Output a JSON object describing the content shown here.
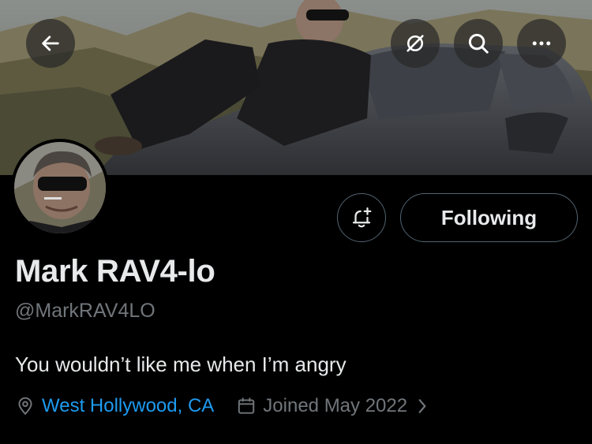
{
  "header": {
    "back_icon": "arrow-left-icon",
    "actions": [
      {
        "name": "grok-icon"
      },
      {
        "name": "search-icon"
      },
      {
        "name": "more-icon"
      }
    ]
  },
  "profile": {
    "display_name": "Mark RAV4-lo",
    "handle": "@MarkRAV4LO",
    "bio": "You wouldn’t like me when I’m angry",
    "location": "West Hollywood, CA",
    "joined": "Joined May 2022",
    "follow_button_label": "Following",
    "notification_icon": "bell-plus-icon"
  },
  "colors": {
    "background": "#000000",
    "text_primary": "#e7e9ea",
    "text_secondary": "#71767b",
    "link": "#1d9bf0",
    "border": "#536471"
  }
}
